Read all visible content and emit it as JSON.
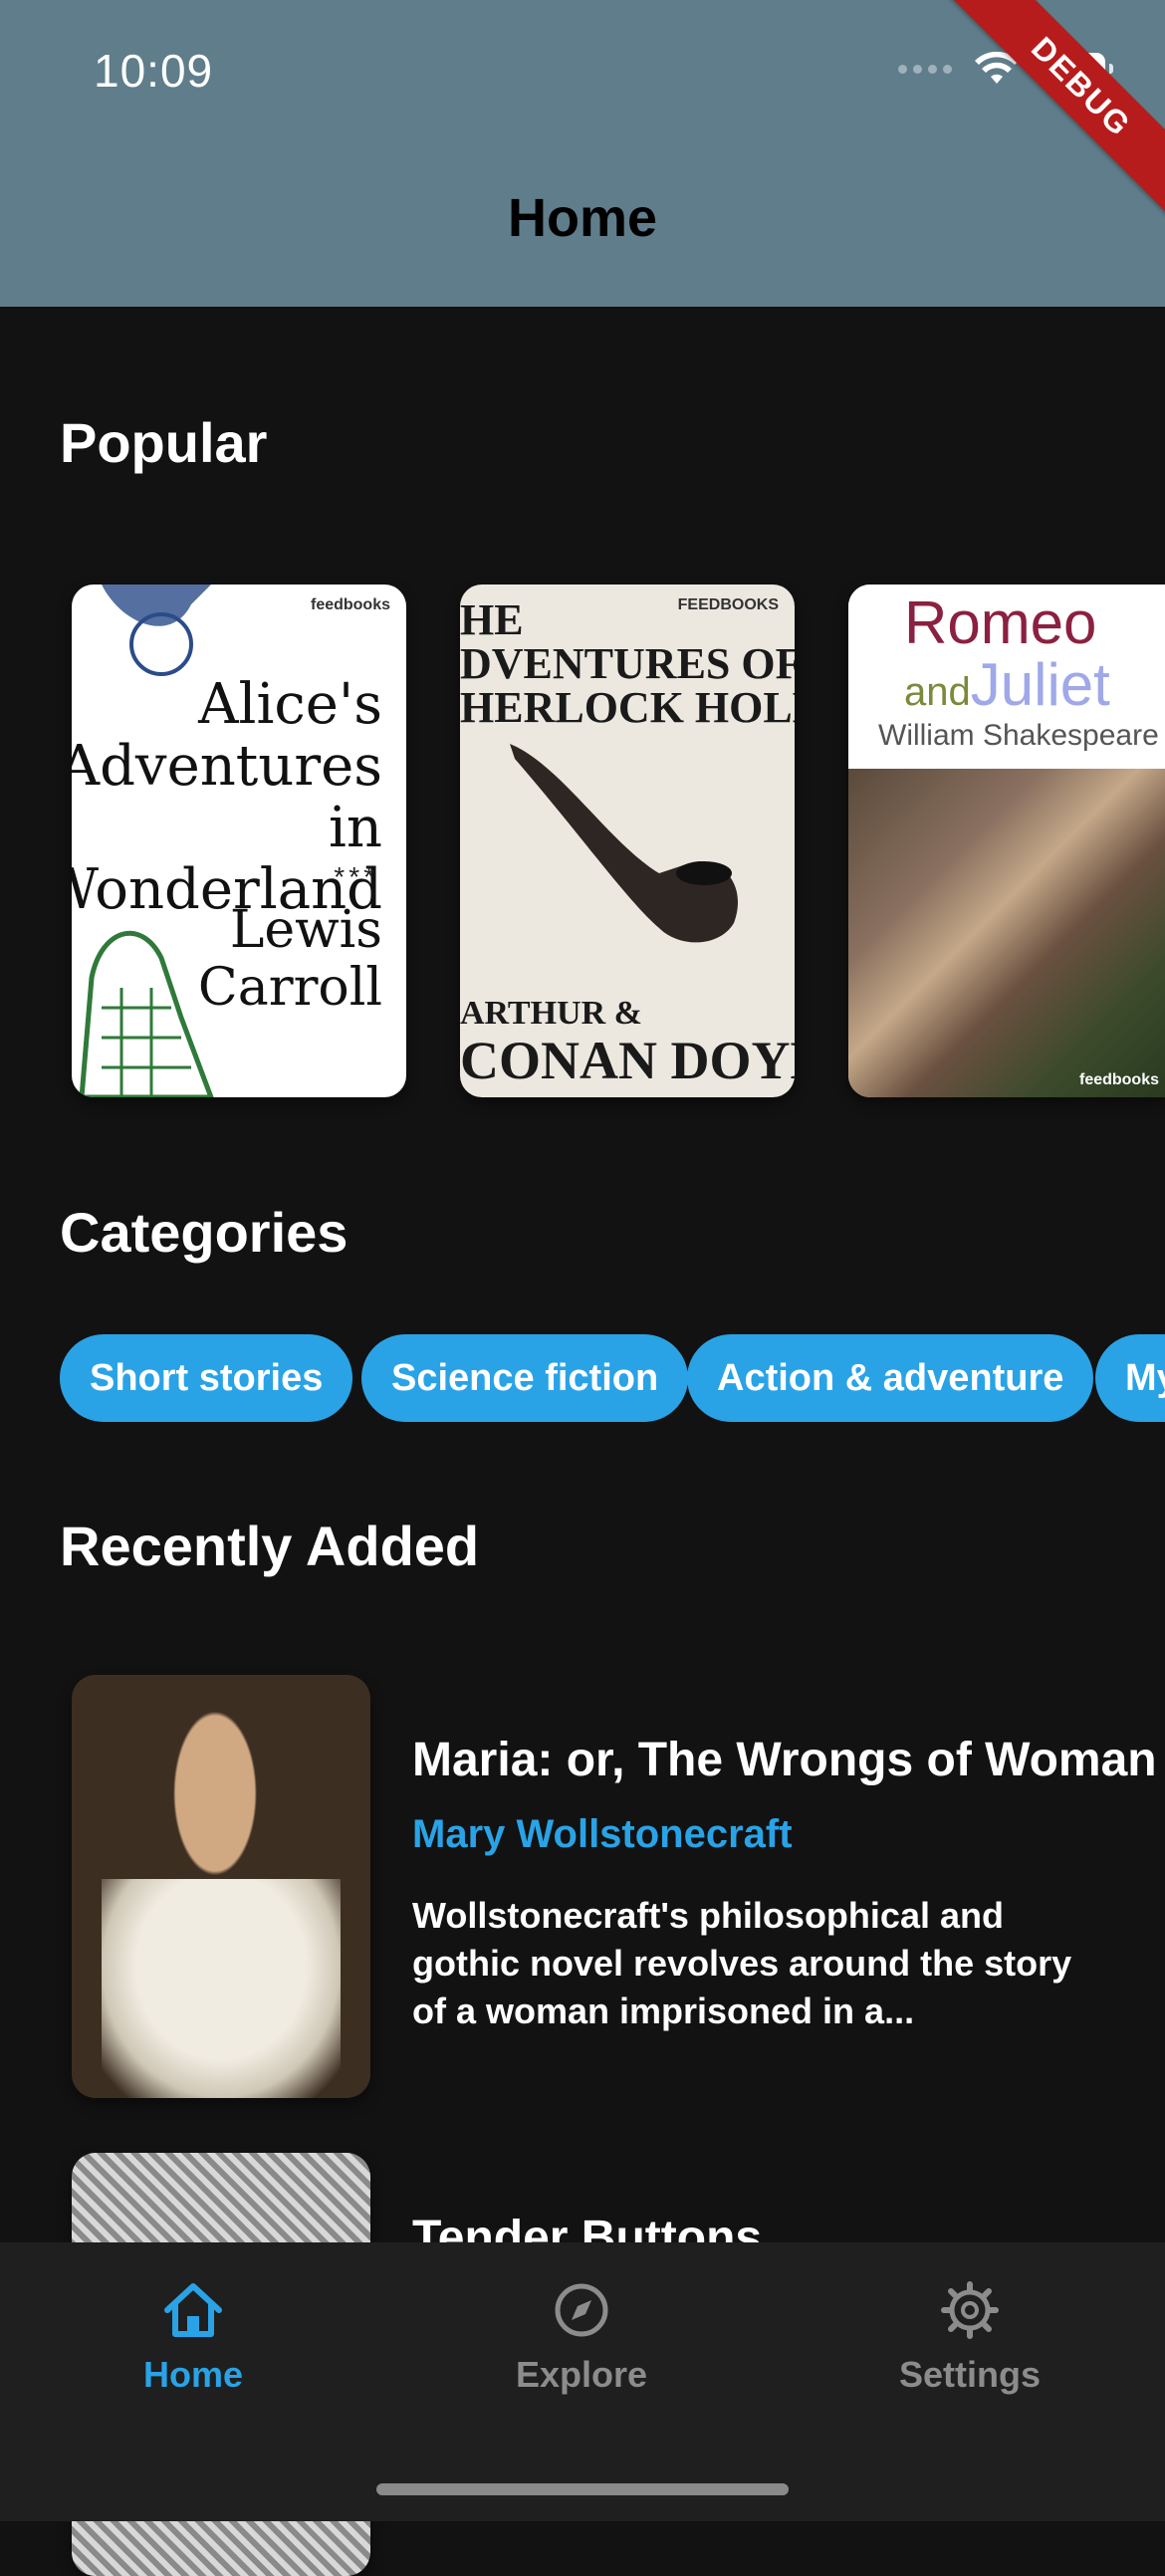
{
  "status_bar": {
    "time": "10:09"
  },
  "debug_banner": "DEBUG",
  "app_bar": {
    "title": "Home"
  },
  "popular": {
    "title": "Popular",
    "books": [
      {
        "title_lines": [
          "Alice's",
          "Adventures in",
          "Wonderland"
        ],
        "stars": "***",
        "author_lines": [
          "Lewis",
          "Carroll"
        ],
        "publisher": "feedbooks"
      },
      {
        "title_lines": [
          "HE",
          "DVENTURES OF",
          "HERLOCK HOLME"
        ],
        "author_lines": [
          "ARTHUR &",
          "CONAN DOYLE"
        ],
        "publisher": "FEEDBOOKS"
      },
      {
        "title_main": "Romeo",
        "title_and": "and",
        "title_second": "Juliet",
        "author": "William Shakespeare",
        "publisher": "feedbooks"
      }
    ]
  },
  "categories": {
    "title": "Categories",
    "items": [
      "Short stories",
      "Science fiction",
      "Action & adventure",
      "My"
    ]
  },
  "recently_added": {
    "title": "Recently Added",
    "books": [
      {
        "title": "Maria: or, The Wrongs of Woman",
        "author": "Mary Wollstonecraft",
        "description": "Wollstonecraft's philosophical and gothic novel revolves around the story of a woman imprisoned in a..."
      },
      {
        "title": "Tender Buttons"
      }
    ]
  },
  "bottom_nav": {
    "active_color": "#29a3e6",
    "inactive_color": "#8c8c8c",
    "items": [
      {
        "label": "Home",
        "icon": "home-icon",
        "active": true
      },
      {
        "label": "Explore",
        "icon": "compass-icon",
        "active": false
      },
      {
        "label": "Settings",
        "icon": "gear-icon",
        "active": false
      }
    ]
  }
}
